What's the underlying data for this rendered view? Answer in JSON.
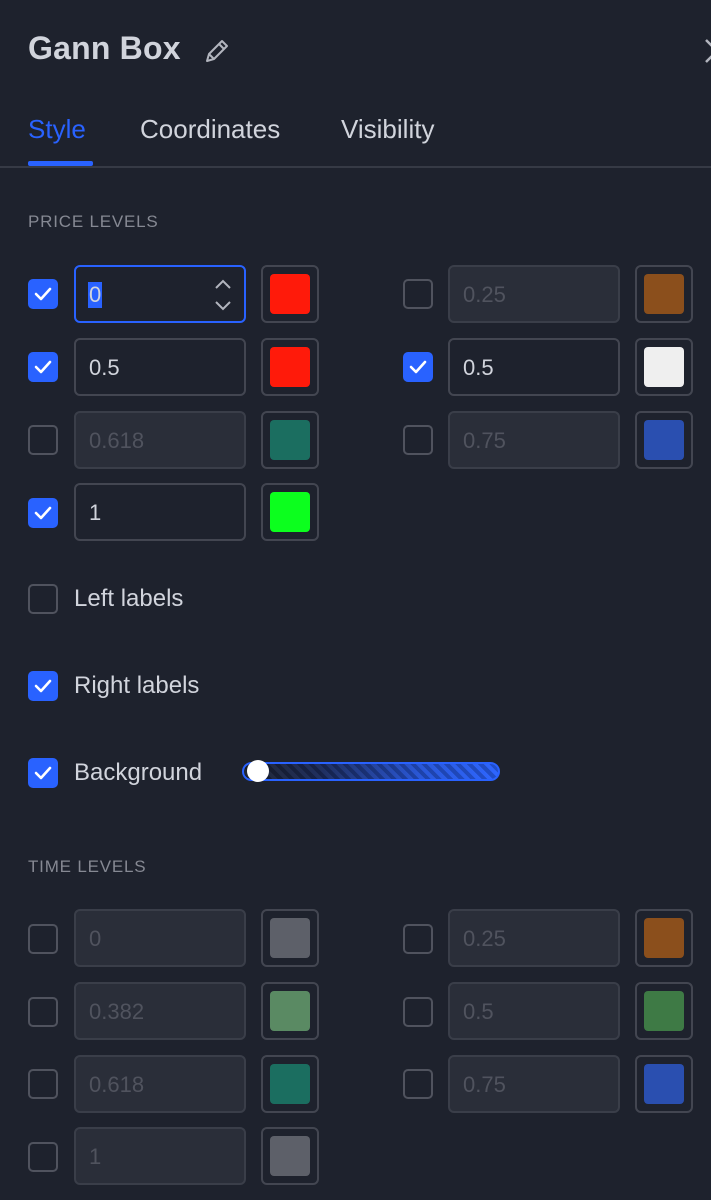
{
  "dialog": {
    "title": "Gann Box"
  },
  "tabs": [
    {
      "label": "Style",
      "active": true
    },
    {
      "label": "Coordinates",
      "active": false
    },
    {
      "label": "Visibility",
      "active": false
    }
  ],
  "price_levels": {
    "heading": "PRICE LEVELS",
    "items": [
      {
        "value": "0",
        "checked": true,
        "color": "#ff1a0a",
        "focused": true
      },
      {
        "value": "0.25",
        "checked": false,
        "color": "#8b4f1c"
      },
      {
        "value": "0.5",
        "checked": true,
        "color": "#ff1a0a"
      },
      {
        "value": "0.5",
        "checked": true,
        "color": "#efefef"
      },
      {
        "value": "0.618",
        "checked": false,
        "color": "#1b6e60"
      },
      {
        "value": "0.75",
        "checked": false,
        "color": "#2a4fb0"
      },
      {
        "value": "1",
        "checked": true,
        "color": "#0cff1e"
      }
    ]
  },
  "options": {
    "left_labels": {
      "label": "Left labels",
      "checked": false
    },
    "right_labels": {
      "label": "Right labels",
      "checked": true
    },
    "background": {
      "label": "Background",
      "checked": true,
      "opacity": 0.05
    }
  },
  "time_levels": {
    "heading": "TIME LEVELS",
    "items": [
      {
        "value": "0",
        "checked": false,
        "color": "#5d6069"
      },
      {
        "value": "0.25",
        "checked": false,
        "color": "#8b4f1c"
      },
      {
        "value": "0.382",
        "checked": false,
        "color": "#5a8a63"
      },
      {
        "value": "0.5",
        "checked": false,
        "color": "#3e7a45"
      },
      {
        "value": "0.618",
        "checked": false,
        "color": "#1b6e60"
      },
      {
        "value": "0.75",
        "checked": false,
        "color": "#2a4fb0"
      },
      {
        "value": "1",
        "checked": false,
        "color": "#5d6069"
      }
    ]
  },
  "colors": {
    "accent": "#2962ff",
    "background": "#1e222d"
  }
}
